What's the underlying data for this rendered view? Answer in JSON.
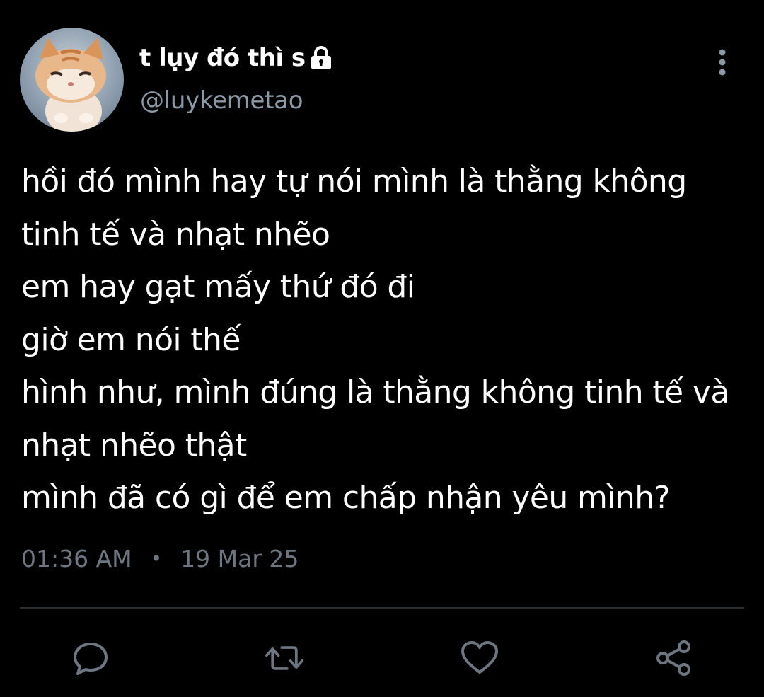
{
  "author": {
    "display_name": "t lụy đó thì s",
    "handle": "@luykemetao",
    "avatar_icon": "kitten-avatar",
    "verified_icon": "lock-icon"
  },
  "tweet": {
    "lines": [
      "hồi đó mình hay tự nói mình là thằng không",
      "tinh tế và nhạt nhẽo",
      "em hay gạt mấy thứ đó đi",
      "giờ em nói thế",
      "hình như, mình đúng là thằng không tinh tế và",
      "nhạt nhẽo thật",
      "mình đã có gì để em chấp nhận yêu mình?"
    ],
    "time": "01:36 AM",
    "separator": "•",
    "date": "19 Mar 25"
  },
  "actions": {
    "icons": [
      "reply-icon",
      "retweet-icon",
      "like-icon",
      "share-icon"
    ]
  },
  "colors": {
    "background": "#000000",
    "text": "#ffffff",
    "muted": "#8b98a5",
    "meta": "#6e7781",
    "icon": "#6e7781"
  }
}
